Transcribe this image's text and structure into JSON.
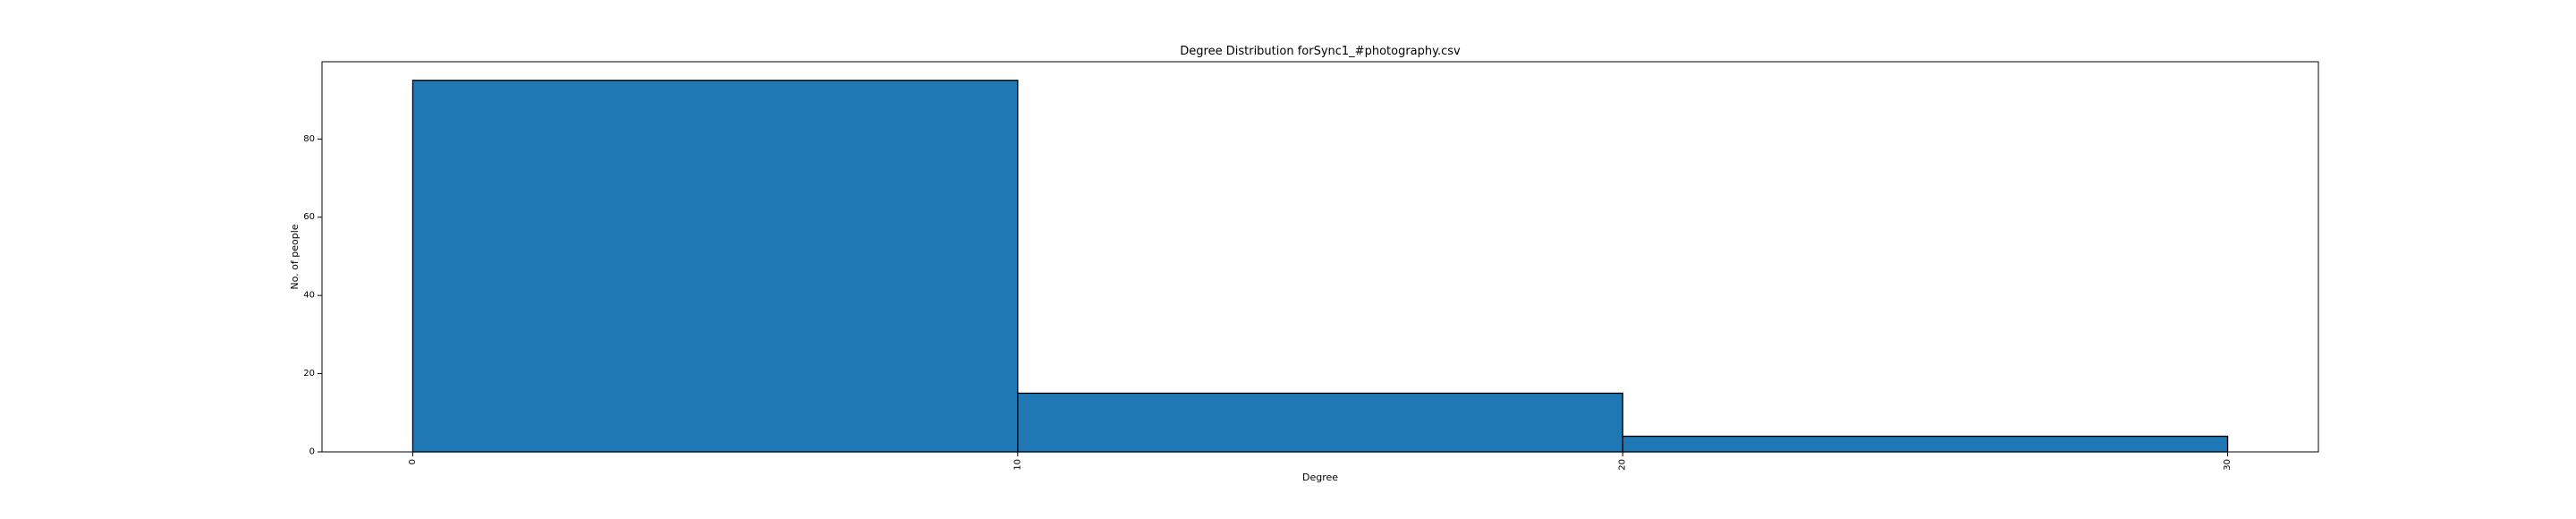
{
  "chart_data": {
    "type": "bar",
    "title": "Degree Distribution forSync1_#photography.csv",
    "xlabel": "Degree",
    "ylabel": "No. of people",
    "bins": [
      {
        "x_start": 0,
        "x_end": 10,
        "value": 95
      },
      {
        "x_start": 10,
        "x_end": 20,
        "value": 15
      },
      {
        "x_start": 20,
        "x_end": 30,
        "value": 4
      }
    ],
    "xlim": [
      -1.5,
      31.5
    ],
    "ylim": [
      0,
      99.75
    ],
    "xticks": [
      0,
      10,
      20,
      30
    ],
    "yticks": [
      0,
      20,
      40,
      60,
      80
    ],
    "x_tick_labels": [
      "0",
      "10",
      "20",
      "30"
    ],
    "y_tick_labels": [
      "0",
      "20",
      "40",
      "60",
      "80"
    ],
    "x_tick_rotation": "vertical",
    "bar_color": "#1f77b4",
    "edge_color": "#000000",
    "grid": false,
    "legend": "none"
  }
}
